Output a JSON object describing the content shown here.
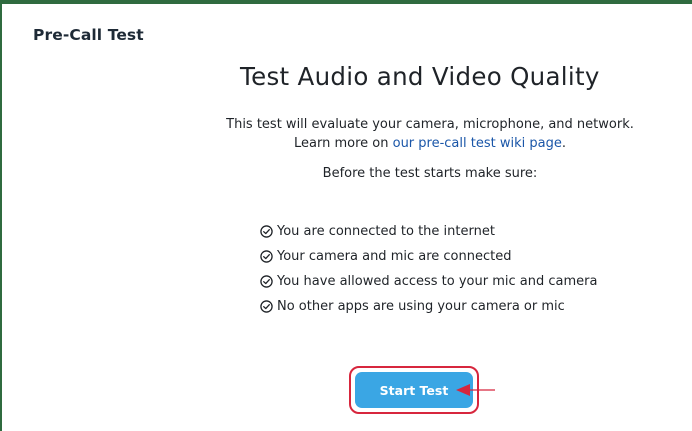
{
  "header": {
    "title": "Pre-Call Test"
  },
  "main": {
    "title": "Test Audio and Video Quality",
    "description_line1": "This test will evaluate your camera, microphone, and network.",
    "description_line2_prefix": "Learn more on ",
    "wiki_link_text": "our pre-call test wiki page",
    "description_line2_suffix": ".",
    "before_text": "Before the test starts make sure:",
    "checklist": [
      "You are connected to the internet",
      "Your camera and mic are connected",
      "You have allowed access to your mic and camera",
      "No other apps are using your camera or mic"
    ],
    "start_button_label": "Start Test"
  },
  "colors": {
    "frame_border": "#2f6b3f",
    "button_bg": "#3aa6e4",
    "highlight_red": "#d7263d",
    "link": "#1a56a8"
  },
  "icons": {
    "check": "check-circle-icon",
    "arrow": "arrow-left-icon"
  }
}
